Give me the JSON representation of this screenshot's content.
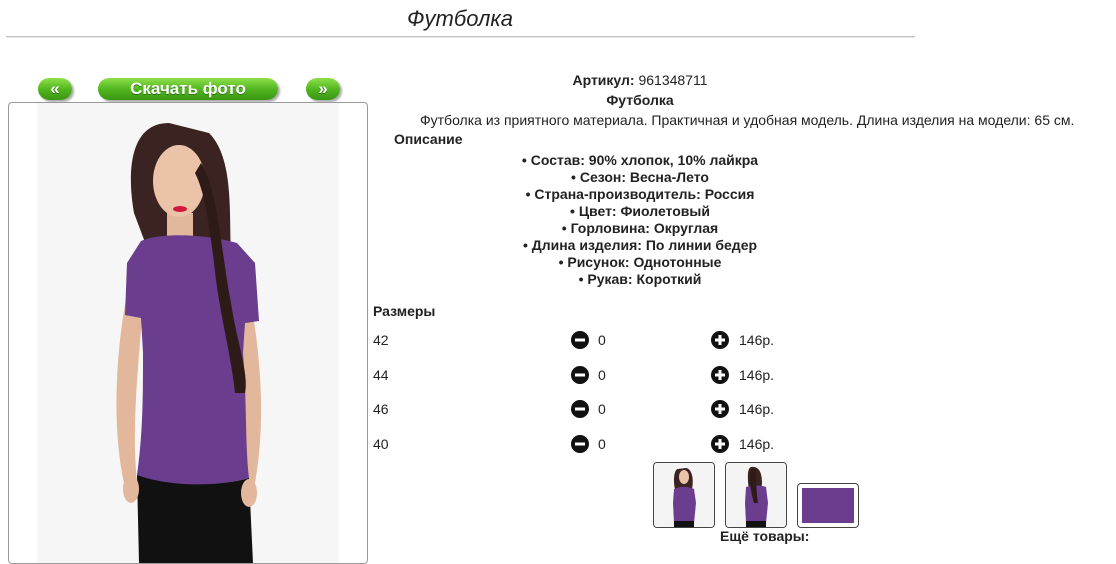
{
  "page": {
    "title": "Футболка"
  },
  "gallery": {
    "prev_label": "«",
    "download_label": "Скачать фото",
    "next_label": "»"
  },
  "product": {
    "article_label": "Артикул:",
    "article_value": "961348711",
    "name": "Футболка",
    "description": "Футболка из приятного материала. Практичная и удобная модель. Длина изделия на модели: 65 см.",
    "description_heading": "Описание",
    "attributes": [
      "Состав: 90% хлопок, 10% лайкра",
      "Сезон: Весна-Лето",
      "Страна-производитель: Россия",
      "Цвет: Фиолетовый",
      "Горловина: Округлая",
      "Длина изделия: По линии бедер",
      "Рисунок: Однотонные",
      "Рукав: Короткий"
    ]
  },
  "sizes": {
    "heading": "Размеры",
    "rows": [
      {
        "size": "42",
        "qty": "0",
        "price": "146р."
      },
      {
        "size": "44",
        "qty": "0",
        "price": "146р."
      },
      {
        "size": "46",
        "qty": "0",
        "price": "146р."
      },
      {
        "size": "40",
        "qty": "0",
        "price": "146р."
      }
    ]
  },
  "more_label": "Ещё товары:",
  "colors": {
    "accent_green": "#4fb31c",
    "shirt_purple": "#6a3d8f"
  }
}
